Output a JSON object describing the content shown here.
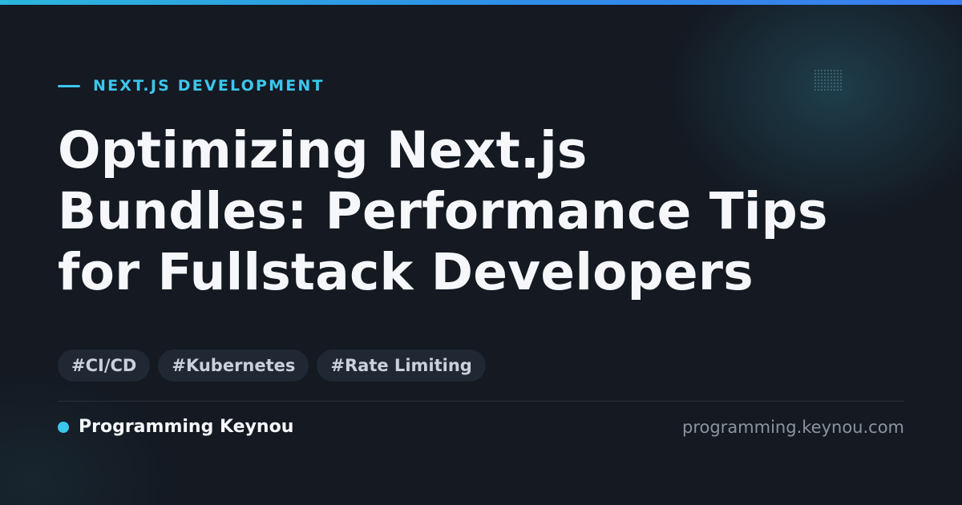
{
  "category": {
    "label": "NEXT.JS DEVELOPMENT"
  },
  "title": {
    "line1": "Optimizing Next.js",
    "line2": "Bundles: Performance Tips",
    "line3": "for Fullstack Developers"
  },
  "tags": [
    "#CI/CD",
    "#Kubernetes",
    "#Rate Limiting"
  ],
  "footer": {
    "brand_name": "Programming Keynou",
    "site_url": "programming.keynou.com"
  },
  "colors": {
    "accent": "#3cc6ec",
    "background": "#141922",
    "top_bar_start": "#2bb6dc",
    "top_bar_end": "#3a7df0",
    "tag_background": "#1f2833"
  }
}
